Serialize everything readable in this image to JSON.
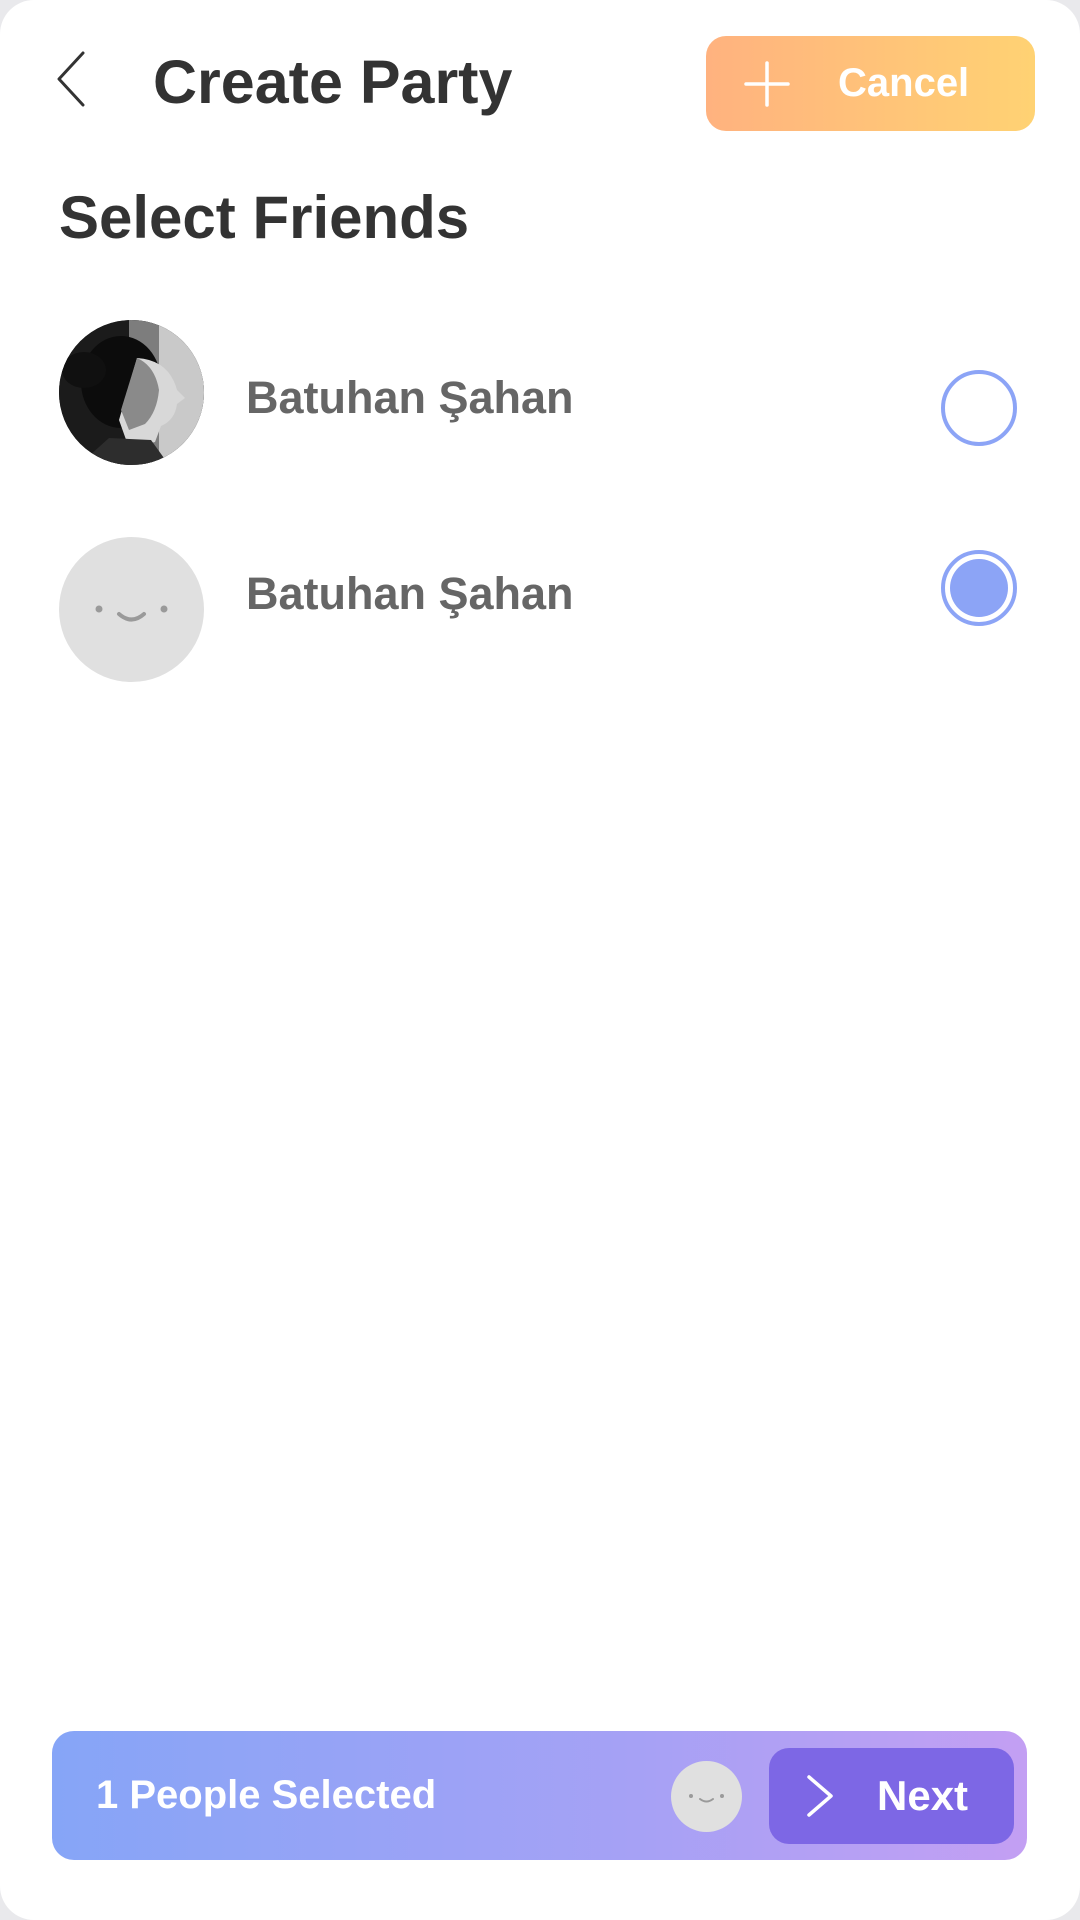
{
  "header": {
    "back_icon": "chevron-left-icon",
    "title": "Create Party",
    "cancel_button": {
      "icon": "plus-icon",
      "label": "Cancel"
    }
  },
  "section": {
    "title": "Select Friends"
  },
  "friends": [
    {
      "name": "Batuhan Şahan",
      "avatar": "photo",
      "selected": false
    },
    {
      "name": "Batuhan Şahan",
      "avatar": "placeholder-face-icon",
      "selected": true
    }
  ],
  "bottom_bar": {
    "selected_text": "1 People Selected",
    "avatar": "placeholder-face-icon",
    "next_button": {
      "icon": "chevron-right-icon",
      "label": "Next"
    }
  },
  "colors": {
    "accent_blue": "#8ca4f6",
    "cancel_gradient_start": "#ffb27f",
    "cancel_gradient_end": "#ffd273",
    "bar_gradient_start": "#86a5f7",
    "bar_gradient_end": "#c39ff3",
    "next_button": "#7d67e5",
    "title_text": "#333333",
    "name_text": "#666666"
  }
}
